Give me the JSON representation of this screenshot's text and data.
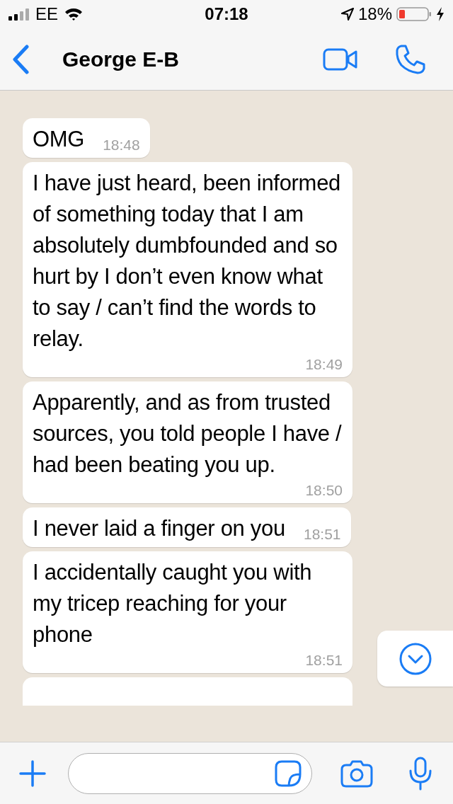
{
  "status_bar": {
    "carrier": "EE",
    "time": "07:18",
    "battery": "18%"
  },
  "header": {
    "contact": "George E-B"
  },
  "messages": [
    {
      "text": "OMG",
      "time": "18:48"
    },
    {
      "text": "I have just heard, been informed of something today that I am absolutely dumbfounded and so hurt by I don’t even know what to say / can’t find the words to relay.",
      "time": "18:49"
    },
    {
      "text": "Apparently, and as from trusted sources, you told people I have / had been beating you up.",
      "time": "18:50"
    },
    {
      "text": "I never laid a finger on you",
      "time": "18:51"
    },
    {
      "text": "I accidentally caught you with my tricep reaching for your phone",
      "time": "18:51"
    }
  ]
}
